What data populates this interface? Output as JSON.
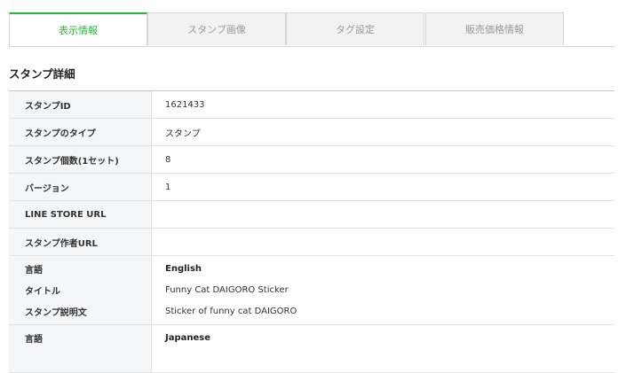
{
  "tabs": [
    {
      "label": "表示情報",
      "active": true
    },
    {
      "label": "スタンプ画像",
      "active": false
    },
    {
      "label": "タグ設定",
      "active": false
    },
    {
      "label": "販売価格情報",
      "active": false
    }
  ],
  "section_title": "スタンプ詳細",
  "details": {
    "sticker_id": {
      "label": "スタンプID",
      "value": "1621433"
    },
    "sticker_type": {
      "label": "スタンプのタイプ",
      "value": "スタンプ"
    },
    "sticker_count": {
      "label": "スタンプ個数(1セット)",
      "value": "8"
    },
    "version": {
      "label": "バージョン",
      "value": "1"
    },
    "store_url": {
      "label": "LINE STORE URL",
      "value": ""
    },
    "creator_url": {
      "label": "スタンプ作者URL",
      "value": ""
    }
  },
  "languages": [
    {
      "language_label": "言語",
      "language": "English",
      "title_label": "タイトル",
      "title": "Funny Cat DAIGORO Sticker",
      "description_label": "スタンプ説明文",
      "description": "Sticker of funny cat DAIGORO"
    },
    {
      "language_label": "言語",
      "language": "Japanese"
    }
  ],
  "colors": {
    "accent": "#2bb535",
    "label_bg": "#f5f6f8",
    "tab_bg": "#f2f2f2"
  }
}
